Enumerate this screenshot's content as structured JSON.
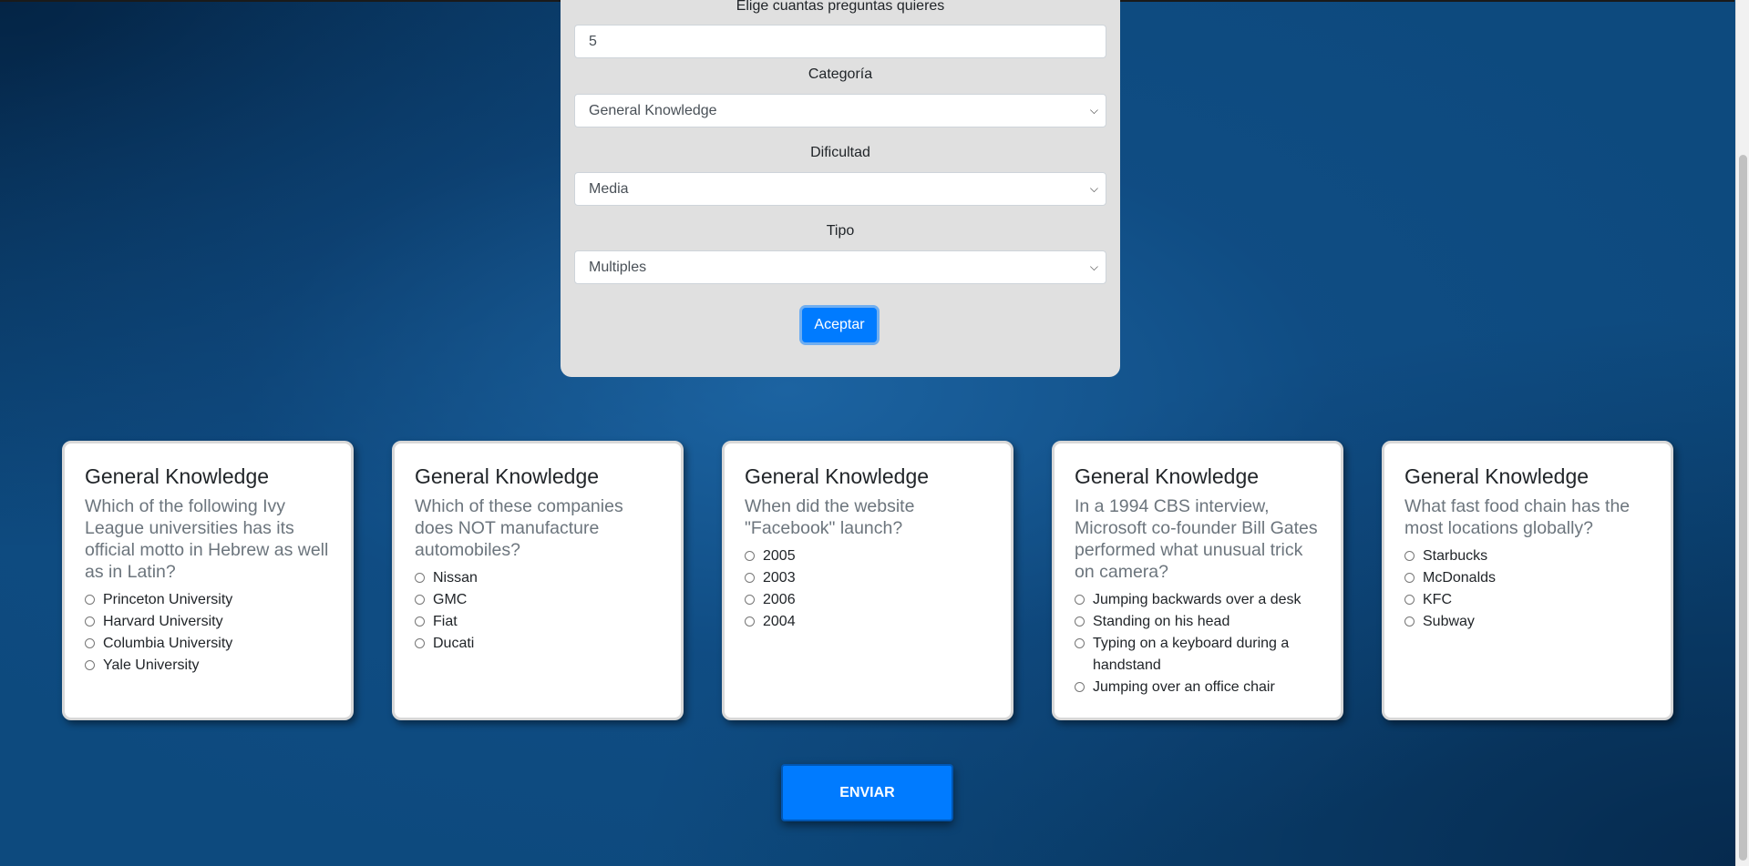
{
  "form": {
    "count_label": "Elige cuantas preguntas quieres",
    "count_value": "5",
    "category_label": "Categoría",
    "category_value": "General Knowledge",
    "difficulty_label": "Dificultad",
    "difficulty_value": "Media",
    "type_label": "Tipo",
    "type_value": "Multiples",
    "accept_label": "Aceptar"
  },
  "cards": [
    {
      "category": "General Knowledge",
      "question": "Which of the following Ivy League universities has its official motto in Hebrew as well as in Latin?",
      "options": [
        "Princeton University",
        "Harvard University",
        "Columbia University",
        "Yale University"
      ]
    },
    {
      "category": "General Knowledge",
      "question": "Which of these companies does NOT manufacture automobiles?",
      "options": [
        "Nissan",
        "GMC",
        "Fiat",
        "Ducati"
      ]
    },
    {
      "category": "General Knowledge",
      "question": "When did the website \"Facebook\" launch?",
      "options": [
        "2005",
        "2003",
        "2006",
        "2004"
      ]
    },
    {
      "category": "General Knowledge",
      "question": "In a 1994 CBS interview, Microsoft co-founder Bill Gates performed what unusual trick on camera?",
      "options": [
        "Jumping backwards over a desk",
        "Standing on his head",
        "Typing on a keyboard during a handstand",
        "Jumping over an office chair"
      ]
    },
    {
      "category": "General Knowledge",
      "question": "What fast food chain has the most locations globally?",
      "options": [
        "Starbucks",
        "McDonalds",
        "KFC",
        "Subway"
      ]
    }
  ],
  "send_label": "ENVIAR",
  "icons": {
    "select_arrow": "chevron-down-icon"
  }
}
